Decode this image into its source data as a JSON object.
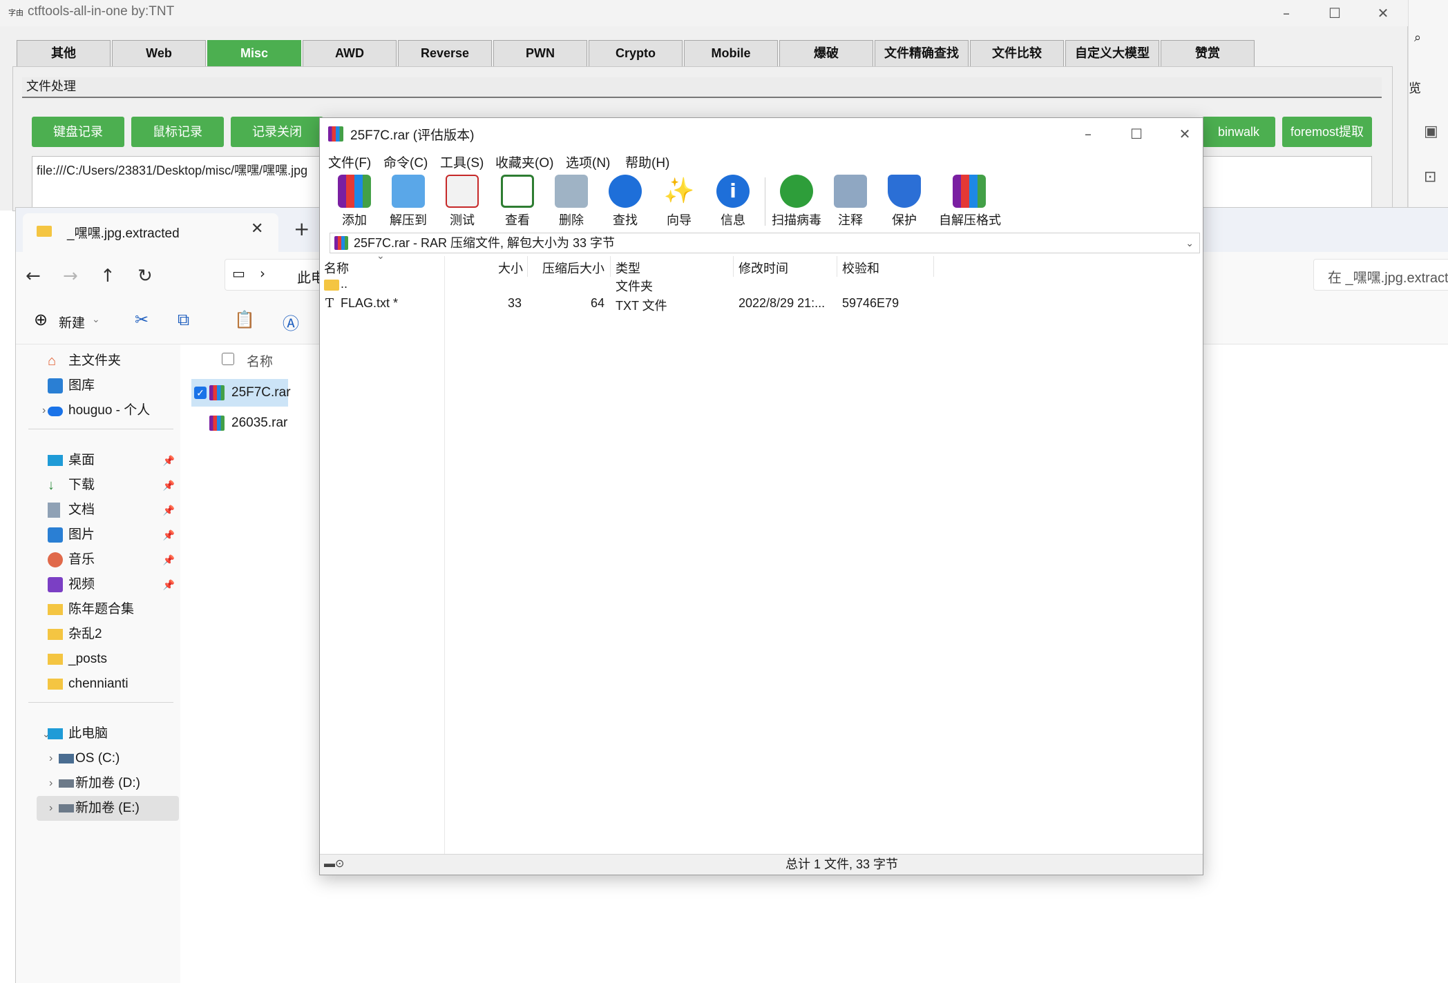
{
  "ctftools": {
    "title": "ctftools-all-in-one   by:TNT",
    "app_icon_text": "字由",
    "tabs": [
      "其他",
      "Web",
      "Misc",
      "AWD",
      "Reverse",
      "PWN",
      "Crypto",
      "Mobile",
      "爆破",
      "文件精确查找",
      "文件比较",
      "自定义大模型",
      "赞赏"
    ],
    "active_tab": "Misc",
    "section_title": "文件处理",
    "buttons": [
      "键盘记录",
      "鼠标记录",
      "记录关闭",
      "binwalk",
      "foremost提取"
    ],
    "path_value": "file:///C:/Users/23831/Desktop/misc/嘿嘿/嘿嘿.jpg",
    "right_strip_text": "览"
  },
  "explorer": {
    "tab_label": "_嘿嘿.jpg.extracted",
    "address_partial": "此电",
    "search_placeholder": "在 _嘿嘿.jpg.extracted 中搜索",
    "new_button": "新建",
    "sidebar": [
      {
        "label": "主文件夹",
        "icon": "home-icon"
      },
      {
        "label": "图库",
        "icon": "gallery-icon"
      },
      {
        "label": "houguo - 个人",
        "icon": "cloud-icon"
      },
      {
        "label": "桌面",
        "icon": "desktop-icon"
      },
      {
        "label": "下载",
        "icon": "download-icon"
      },
      {
        "label": "文档",
        "icon": "document-icon"
      },
      {
        "label": "图片",
        "icon": "pictures-icon"
      },
      {
        "label": "音乐",
        "icon": "music-icon"
      },
      {
        "label": "视频",
        "icon": "video-icon"
      },
      {
        "label": "陈年题合集",
        "icon": "folder-icon"
      },
      {
        "label": "杂乱2",
        "icon": "folder-icon"
      },
      {
        "label": "_posts",
        "icon": "folder-icon"
      },
      {
        "label": "chennianti",
        "icon": "folder-icon"
      },
      {
        "label": "此电脑",
        "icon": "computer-icon"
      },
      {
        "label": "OS (C:)",
        "icon": "drive-icon"
      },
      {
        "label": "新加卷 (D:)",
        "icon": "drive-icon"
      },
      {
        "label": "新加卷 (E:)",
        "icon": "drive-icon"
      }
    ],
    "column_name": "名称",
    "files": [
      "25F7C.rar",
      "26035.rar"
    ]
  },
  "winrar": {
    "title": "25F7C.rar (评估版本)",
    "menu": [
      "文件(F)",
      "命令(C)",
      "工具(S)",
      "收藏夹(O)",
      "选项(N)",
      "帮助(H)"
    ],
    "toolbar": [
      "添加",
      "解压到",
      "测试",
      "查看",
      "删除",
      "查找",
      "向导",
      "信息",
      "扫描病毒",
      "注释",
      "保护",
      "自解压格式"
    ],
    "path_text": "25F7C.rar - RAR 压缩文件, 解包大小为 33 字节",
    "columns": [
      "名称",
      "大小",
      "压缩后大小",
      "类型",
      "修改时间",
      "校验和"
    ],
    "rows": [
      {
        "name": "..",
        "size": "",
        "packed": "",
        "type": "文件夹",
        "modified": "",
        "crc": ""
      },
      {
        "name": "FLAG.txt *",
        "size": "33",
        "packed": "64",
        "type": "TXT 文件",
        "modified": "2022/8/29 21:...",
        "crc": "59746E79"
      }
    ],
    "status": "总计 1 文件, 33 字节"
  }
}
